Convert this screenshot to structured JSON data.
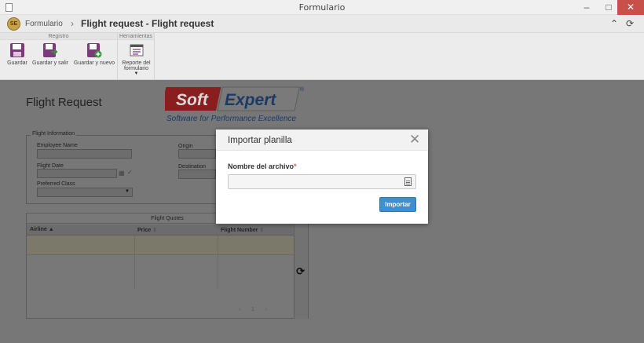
{
  "window": {
    "title": "Formulario"
  },
  "header": {
    "breadcrumb": "Formulario",
    "separator": "›",
    "title": "Flight request - Flight request",
    "logo_text": "SE"
  },
  "toolbar": {
    "groups": [
      {
        "title": "Registro",
        "buttons": [
          {
            "label": "Guardar"
          },
          {
            "label": "Guardar y salir"
          },
          {
            "label": "Guardar y nuevo"
          }
        ]
      },
      {
        "title": "Herramientas",
        "buttons": [
          {
            "label": "Reporte del formulario"
          }
        ]
      }
    ]
  },
  "form": {
    "title": "Flight Request",
    "logo": {
      "brand_left": "Soft",
      "brand_right": "Expert",
      "registered": "®",
      "tagline": "Software for Performance Excellence"
    },
    "section": {
      "legend": "Flight Information",
      "fields": {
        "employee_name": "Employee Name",
        "flight_date": "Flight Date",
        "preferred_class": "Preferred Class",
        "origin": "Origin",
        "destination": "Destination"
      }
    },
    "grid": {
      "caption": "Flight Quotes",
      "columns": [
        "Airline",
        "Price",
        "Flight Number"
      ],
      "pager": {
        "prev": "‹",
        "page": "1",
        "next": "›"
      }
    }
  },
  "modal": {
    "title": "Importar planilla",
    "field_label": "Nombre del archivo",
    "required_mark": "*",
    "submit_label": "Importar"
  },
  "colors": {
    "accent": "#3d8fd1",
    "required": "#d9534f",
    "close_button": "#c7504a"
  }
}
